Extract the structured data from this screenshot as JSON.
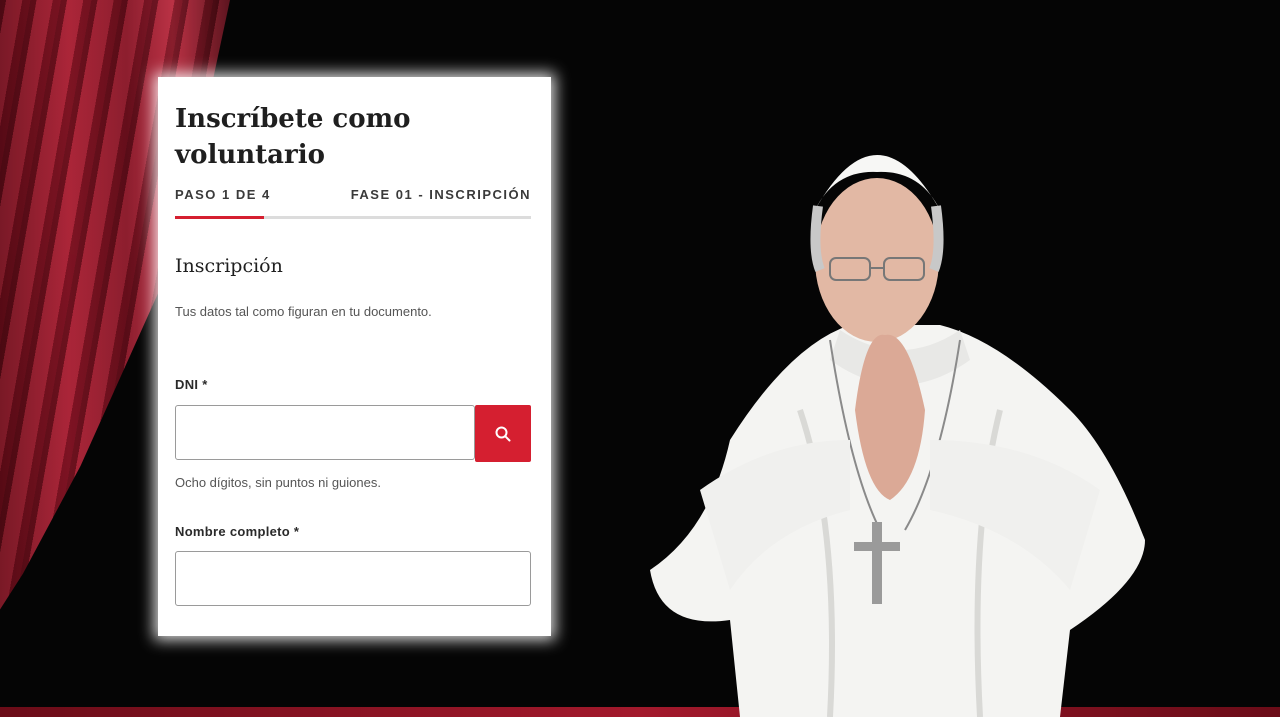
{
  "form": {
    "title": "Inscríbete como voluntario",
    "step_label": "PASO 1 DE 4",
    "phase_label": "FASE 01 - INSCRIPCIÓN",
    "progress_fraction": 0.25,
    "section_title": "Inscripción",
    "section_description": "Tus datos tal como figuran en tu documento.",
    "dni_label": "DNI *",
    "dni_value": "",
    "dni_hint": "Ocho dígitos, sin puntos ni guiones.",
    "search_icon": "search-icon",
    "name_label": "Nombre completo *",
    "name_value": ""
  },
  "colors": {
    "accent": "#d51f30",
    "curtain": "#b01c31"
  }
}
